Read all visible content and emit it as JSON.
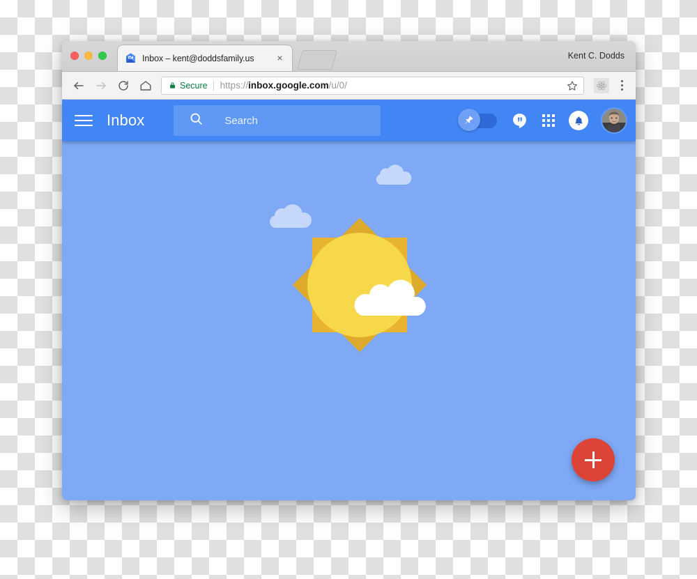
{
  "window": {
    "traffic_lights": [
      "close",
      "minimize",
      "zoom"
    ],
    "profile_name": "Kent C. Dodds",
    "tab": {
      "title": "Inbox – kent@doddsfamily.us",
      "favicon": "inbox-by-gmail-icon",
      "close_label": "×"
    },
    "new_tab_label": ""
  },
  "toolbar": {
    "back_icon": "arrow-left-icon",
    "forward_icon": "arrow-right-icon",
    "reload_icon": "reload-icon",
    "home_icon": "home-icon",
    "security_label": "Secure",
    "lock_icon": "lock-icon",
    "url": {
      "scheme": "https://",
      "host": "inbox.google.com",
      "path": "/u/0/"
    },
    "star_icon": "star-icon",
    "extension_icon": "react-devtools-icon",
    "menu_icon": "three-dot-menu-icon"
  },
  "app": {
    "menu_icon": "hamburger-menu-icon",
    "title": "Inbox",
    "search": {
      "icon": "search-icon",
      "placeholder": "Search"
    },
    "pin_toggle": {
      "icon": "pin-icon",
      "state": "off"
    },
    "hangouts_icon": "hangouts-icon",
    "apps_icon": "apps-grid-icon",
    "notifications_icon": "bell-icon",
    "avatar": "user-avatar",
    "compose": {
      "icon": "plus-icon",
      "label": "+"
    },
    "illustration": "sunny-with-clouds-empty-state"
  },
  "colors": {
    "header_blue": "#4285F4",
    "body_blue": "#7FA9F5",
    "fab_red": "#DB4437",
    "sun_yellow": "#F7D84B",
    "sun_ray": "#E8B32E",
    "secure_green": "#0B8043"
  }
}
